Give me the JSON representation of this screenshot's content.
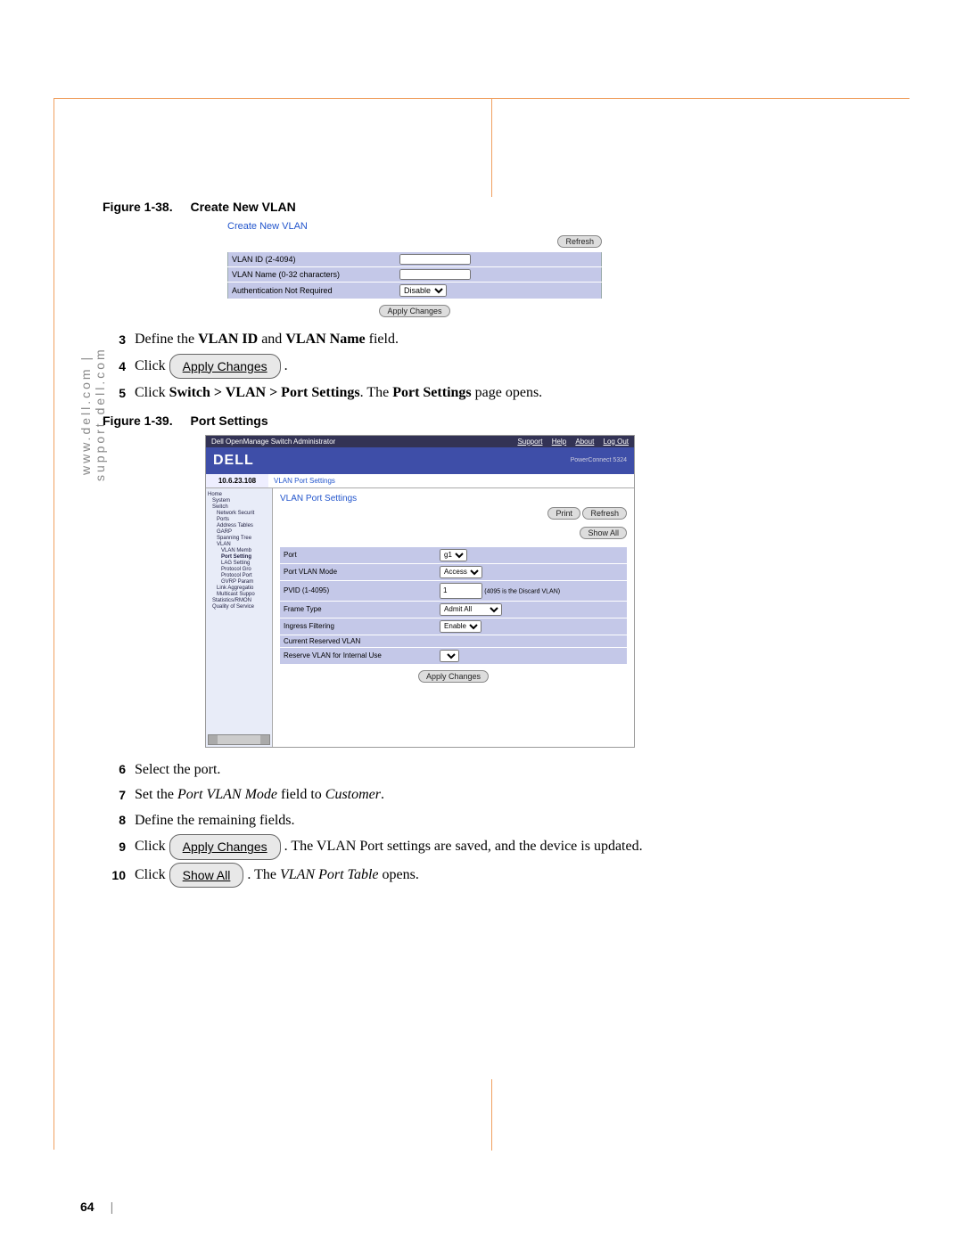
{
  "domain": "Document",
  "page_number": "64",
  "vertical_text": "www.dell.com | support.dell.com",
  "fig38": {
    "caption_num": "Figure 1-38.",
    "caption_title": "Create New VLAN",
    "panel_title": "Create New VLAN",
    "refresh": "Refresh",
    "row1_label": "VLAN ID (2-4094)",
    "row2_label": "VLAN Name (0-32 characters)",
    "row3_label": "Authentication Not Required",
    "row3_value": "Disable",
    "apply": "Apply Changes"
  },
  "steps_a": {
    "s3_num": "3",
    "s3_a": "Define the ",
    "s3_b": "VLAN ID",
    "s3_c": " and ",
    "s3_d": "VLAN Name",
    "s3_e": " field.",
    "s4_num": "4",
    "s4_a": "Click ",
    "s4_btn": "Apply Changes",
    "s4_b": ".",
    "s5_num": "5",
    "s5_a": "Click ",
    "s5_b": "Switch > VLAN > Port Settings",
    "s5_c": ". The ",
    "s5_d": "Port Settings",
    "s5_e": " page opens."
  },
  "fig39": {
    "caption_num": "Figure 1-39.",
    "caption_title": "Port Settings",
    "topbar_left": "Dell OpenManage Switch Administrator",
    "topbar_links": [
      "Support",
      "Help",
      "About",
      "Log Out"
    ],
    "logo": "DELL",
    "model": "PowerConnect 5324",
    "ip": "10.6.23.108",
    "breadcrumb": "VLAN Port Settings",
    "main_title": "VLAN Port Settings",
    "print_btn": "Print",
    "refresh_btn": "Refresh",
    "showall_btn": "Show All",
    "tree": [
      "Home",
      "System",
      "Switch",
      "Network Securit",
      "Ports",
      "Address Tables",
      "GARP",
      "Spanning Tree",
      "VLAN",
      "VLAN Memb",
      "Port Setting",
      "LAG Setting",
      "Protocol Gro",
      "Protocol Port",
      "GVRP Param",
      "Link Aggregatio",
      "Multicast Suppo",
      "Statistics/RMON",
      "Quality of Service"
    ],
    "form": {
      "r1_label": "Port",
      "r1_value": "g1",
      "r2_label": "Port VLAN Mode",
      "r2_value": "Access",
      "r3_label": "PVID (1-4095)",
      "r3_value": "1",
      "r3_note": "(4095 is the Discard VLAN)",
      "r4_label": "Frame Type",
      "r4_value": "Admit All",
      "r5_label": "Ingress Filtering",
      "r5_value": "Enable",
      "r6_label": "Current Reserved VLAN",
      "r7_label": "Reserve VLAN for Internal Use"
    },
    "apply": "Apply Changes"
  },
  "steps_b": {
    "s6_num": "6",
    "s6": "Select the port.",
    "s7_num": "7",
    "s7_a": "Set the ",
    "s7_b": "Port VLAN Mode",
    "s7_c": " field to ",
    "s7_d": "Customer",
    "s7_e": ".",
    "s8_num": "8",
    "s8": "Define the remaining fields.",
    "s9_num": "9",
    "s9_a": "Click ",
    "s9_btn": "Apply Changes",
    "s9_b": ". The VLAN Port settings are saved, and the device is updated.",
    "s10_num": "10",
    "s10_a": "Click ",
    "s10_btn": "Show All",
    "s10_b": ". The ",
    "s10_c": "VLAN Port Table",
    "s10_d": " opens."
  }
}
